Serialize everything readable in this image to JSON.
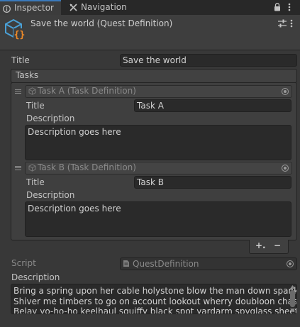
{
  "tabs": [
    {
      "label": "Inspector",
      "icon": "info-icon"
    },
    {
      "label": "Navigation",
      "icon": "navigation-icon"
    }
  ],
  "header": {
    "title": "Save the world (Quest Definition)",
    "icon": "script-object-icon"
  },
  "quest": {
    "title_label": "Title",
    "title_value": "Save the world",
    "tasks_label": "Tasks",
    "script_label": "Script",
    "script_value": "QuestDefinition",
    "description_label": "Description",
    "description_value": "Bring a spring upon her cable holystone blow the man down spanker\nShiver me timbers to go on account lookout wherry doubloon chase.\nBelay yo-ho-ho keelhaul squiffy black spot yardarm spyglass sheet"
  },
  "tasks": [
    {
      "header": "Task A (Task Definition)",
      "title_label": "Title",
      "title_value": "Task A",
      "description_label": "Description",
      "description_value": "Description goes here"
    },
    {
      "header": "Task B (Task Definition)",
      "title_label": "Title",
      "title_value": "Task B",
      "description_label": "Description",
      "description_value": "Description goes here"
    }
  ],
  "list_controls": {
    "add_label": "+.",
    "remove_label": "−"
  },
  "colors": {
    "background": "#383838",
    "field": "#2a2a2a",
    "tab_accent": "#3a79bb",
    "icon_blue": "#4aa0d6",
    "icon_orange": "#f28c28"
  }
}
